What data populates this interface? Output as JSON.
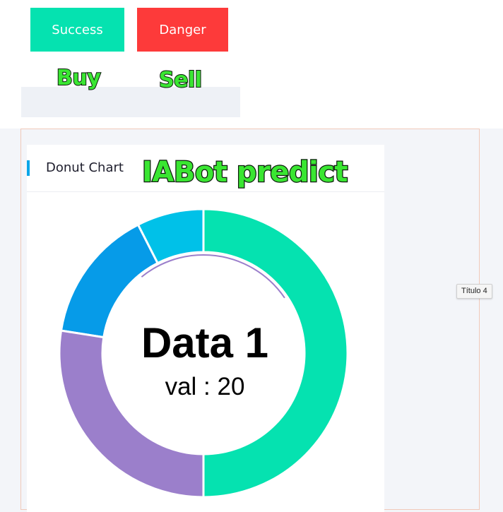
{
  "buttons": {
    "success_label": "Success",
    "danger_label": "Danger"
  },
  "stickers": {
    "buy": "Buy",
    "sell": "Sell",
    "predict": "IABot predict"
  },
  "card": {
    "title": "Donut Chart"
  },
  "tooltip": "Título 4",
  "colors": {
    "success": "#05e2b0",
    "danger": "#fd3a3a",
    "accent": "#0aa6e8"
  },
  "chart_data": {
    "type": "pie",
    "donut": true,
    "center_label": "Data 1",
    "center_value": "val : 20",
    "segments": [
      {
        "value": 20,
        "color": "#05e2b0"
      },
      {
        "value": 3,
        "color": "#00c1e8"
      },
      {
        "value": 6,
        "color": "#069be8"
      },
      {
        "value": 11,
        "color": "#9b7fcb"
      }
    ]
  }
}
